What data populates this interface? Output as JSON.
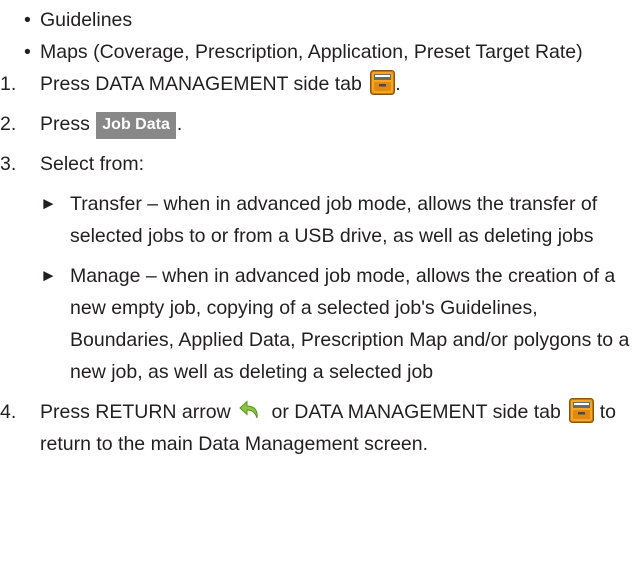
{
  "bullets": [
    "Guidelines",
    "Maps (Coverage, Prescription, Application, Preset Target Rate)"
  ],
  "bullet_glyph": "•",
  "icons": {
    "data_management_tab": "data-management-icon",
    "return_arrow": "return-arrow-icon"
  },
  "steps": {
    "s1": {
      "num": "1.",
      "text": "Press DATA MANAGEMENT side tab",
      "after": "."
    },
    "s2": {
      "num": "2.",
      "pre": "Press",
      "button": "Job Data",
      "after": "."
    },
    "s3": {
      "num": "3.",
      "text": "Select from:",
      "options": [
        {
          "arrow": "►",
          "text": "Transfer – when in advanced job mode, allows the transfer of selected jobs to or from a USB drive, as well as deleting jobs"
        },
        {
          "arrow": "►",
          "text": "Manage – when in advanced job mode, allows the creation of a new empty job, copying of a selected job's Guidelines, Boundaries, Applied Data, Prescription Map and/or polygons to a new job, as well as deleting a selected job"
        }
      ]
    },
    "s4": {
      "num": "4.",
      "pre": "Press RETURN arrow",
      "mid": "or DATA MANAGEMENT side tab",
      "post": "to return to the main Data Management screen."
    }
  },
  "colors": {
    "text": "#231f20",
    "softkey_bg": "#888888",
    "softkey_text": "#ffffff",
    "return_arrow": "#8cc63f",
    "folder_orange": "#f5a623"
  }
}
